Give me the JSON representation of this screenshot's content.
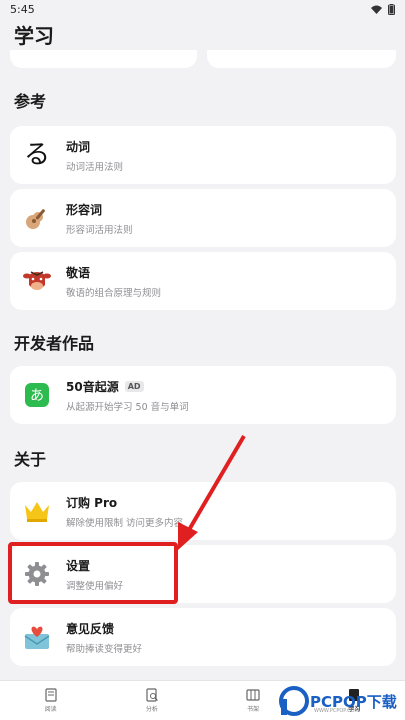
{
  "status_bar": {
    "time": "5:45"
  },
  "page": {
    "title": "学习"
  },
  "sections": {
    "reference": "参考",
    "developer": "开发者作品",
    "about": "关于"
  },
  "cards": {
    "verbs": {
      "title": "动词",
      "subtitle": "动词活用法则",
      "icon_glyph": "る"
    },
    "adjectives": {
      "title": "形容词",
      "subtitle": "形容词活用法则"
    },
    "honorifics": {
      "title": "敬语",
      "subtitle": "敬语的组合原理与规则"
    },
    "kana_origin": {
      "title": "50音起源",
      "badge": "AD",
      "subtitle": "从起源开始学习 50 音与单词",
      "icon_glyph": "あ"
    },
    "subscribe": {
      "title": "订购 Pro",
      "subtitle": "解除使用限制 访问更多内容"
    },
    "settings": {
      "title": "设置",
      "subtitle": "调整使用偏好"
    },
    "feedback": {
      "title": "意见反馈",
      "subtitle": "帮助捧读变得更好"
    }
  },
  "tabs": [
    {
      "label": "阅读"
    },
    {
      "label": "分析"
    },
    {
      "label": "书架"
    },
    {
      "label": "学习"
    }
  ],
  "watermark": {
    "text": "PCPOP下载",
    "sub": "WWW.PCPOP.COM"
  },
  "colors": {
    "accent_red": "#e02020",
    "kana_green": "#2dbb4f",
    "crown_yellow": "#f5c518",
    "watermark_blue": "#1a5fc4"
  }
}
